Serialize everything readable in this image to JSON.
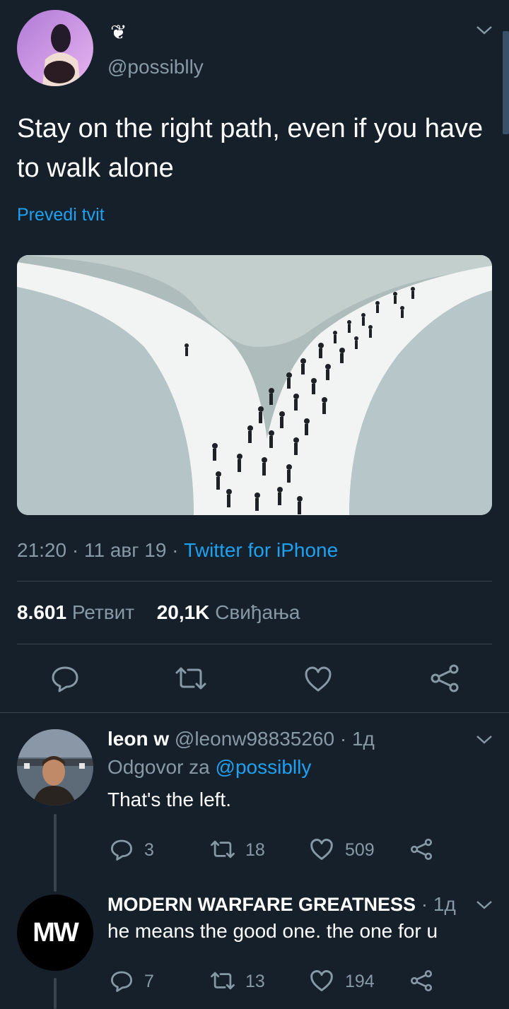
{
  "tweet": {
    "author_badge": "❦",
    "handle": "@possiblly",
    "text": "Stay on the right path, even if you have to walk alone",
    "translate_label": "Prevedi tvit",
    "time": "21:20",
    "date": "11 авг 19",
    "source": "Twitter for iPhone",
    "retweet_count": "8.601",
    "retweet_label": "Ретвит",
    "like_count": "20,1K",
    "like_label": "Свиђања"
  },
  "replies": [
    {
      "name": "leon w",
      "handle": "@leonw98835260",
      "time": "1д",
      "reply_to_prefix": "Odgovor za",
      "reply_to_handle": "@possiblly",
      "text": "That's the left.",
      "replies": "3",
      "retweets": "18",
      "likes": "509"
    },
    {
      "name": "MODERN WARFARE GREATNESS",
      "handle": "",
      "time": "1д",
      "text": "he means the good one. the one for u",
      "avatar_text": "MW",
      "replies": "7",
      "retweets": "13",
      "likes": "194"
    }
  ],
  "colors": {
    "background": "#15202b",
    "accent": "#1da1f2",
    "muted": "#8899a6",
    "divider": "#38444d"
  },
  "icons": [
    "reply-icon",
    "retweet-icon",
    "like-icon",
    "share-icon",
    "chevron-down-icon"
  ]
}
